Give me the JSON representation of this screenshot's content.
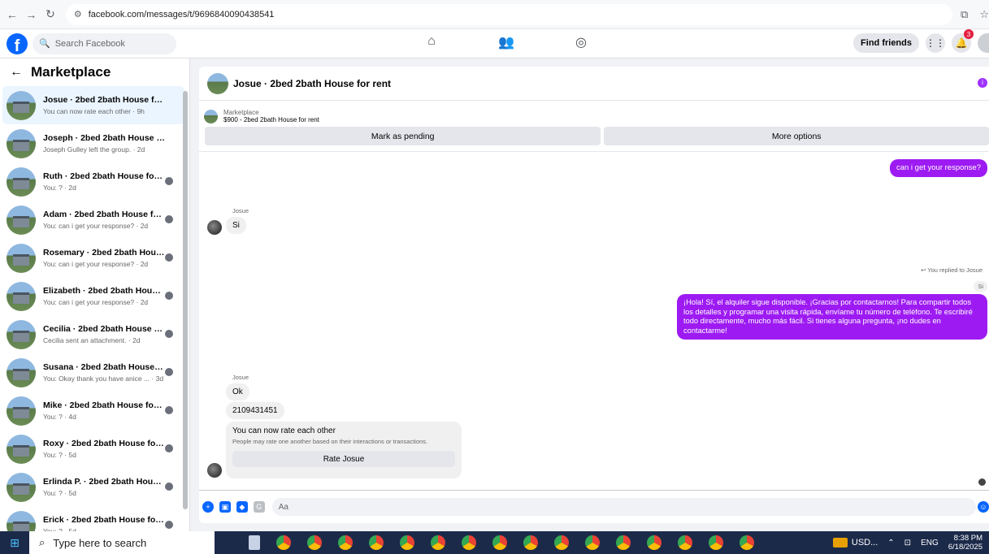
{
  "browser": {
    "url": "facebook.com/messages/t/9696840090438541"
  },
  "header": {
    "search_placeholder": "Search Facebook",
    "find_friends": "Find friends",
    "notification_count": "3"
  },
  "sidebar": {
    "title": "Marketplace",
    "conversations": [
      {
        "name": "Josue · 2bed 2bath House for rent",
        "preview": "You can now rate each other · 9h",
        "active": true
      },
      {
        "name": "Joseph · 2bed 2bath House for r...",
        "preview": "Joseph Gulley left the group. · 2d"
      },
      {
        "name": "Ruth · 2bed 2bath House for r...",
        "preview": "You: ? · 2d"
      },
      {
        "name": "Adam · 2bed 2bath House for...",
        "preview": "You: can i get your response? · 2d"
      },
      {
        "name": "Rosemary · 2bed 2bath House...",
        "preview": "You: can i get your response? · 2d"
      },
      {
        "name": "Elizabeth · 2bed 2bath House ...",
        "preview": "You: can i get your response? · 2d"
      },
      {
        "name": "Cecilia · 2bed 2bath House for r...",
        "preview": "Cecilia sent an attachment. · 2d"
      },
      {
        "name": "Susana · 2bed 2bath House fo...",
        "preview": "You: Okay thank you have anice ... · 3d"
      },
      {
        "name": "Mike · 2bed 2bath House for r...",
        "preview": "You: ? · 4d"
      },
      {
        "name": "Roxy · 2bed 2bath House for r...",
        "preview": "You: ? · 5d"
      },
      {
        "name": "Erlinda P. · 2bed 2bath House fo...",
        "preview": "You: ? · 5d"
      },
      {
        "name": "Erick · 2bed 2bath House for r...",
        "preview": "You: ? · 5d"
      }
    ]
  },
  "chat": {
    "title": "Josue · 2bed 2bath House for rent",
    "marketplace_label": "Marketplace",
    "listing": "$900 - 2bed 2bath House for rent",
    "mark_pending": "Mark as pending",
    "more_options": "More options",
    "messages": {
      "out1": "can i get your response?",
      "sender1": "Josue",
      "in1": "Si",
      "replied_to": "You replied to Josue",
      "quoted": "Si",
      "out2": "¡Hola! Sí, el alquiler sigue disponible. ¡Gracias por contactarnos! Para compartir todos los detalles y programar una visita rápida, envíame tu número de teléfono. Te escribiré todo directamente, mucho más fácil. Si tienes alguna pregunta, ¡no dudes en contactarme!",
      "sender2": "Josue",
      "in2": "Ok",
      "in3": "2109431451"
    },
    "rate_card": {
      "title": "You can now rate each other",
      "subtitle": "People may rate one another based on their interactions or transactions.",
      "button": "Rate Josue"
    },
    "composer_placeholder": "Aa"
  },
  "taskbar": {
    "search_placeholder": "Type here to search",
    "ticker": "USD...",
    "language": "ENG",
    "time": "8:38 PM",
    "date": "6/18/2025"
  }
}
